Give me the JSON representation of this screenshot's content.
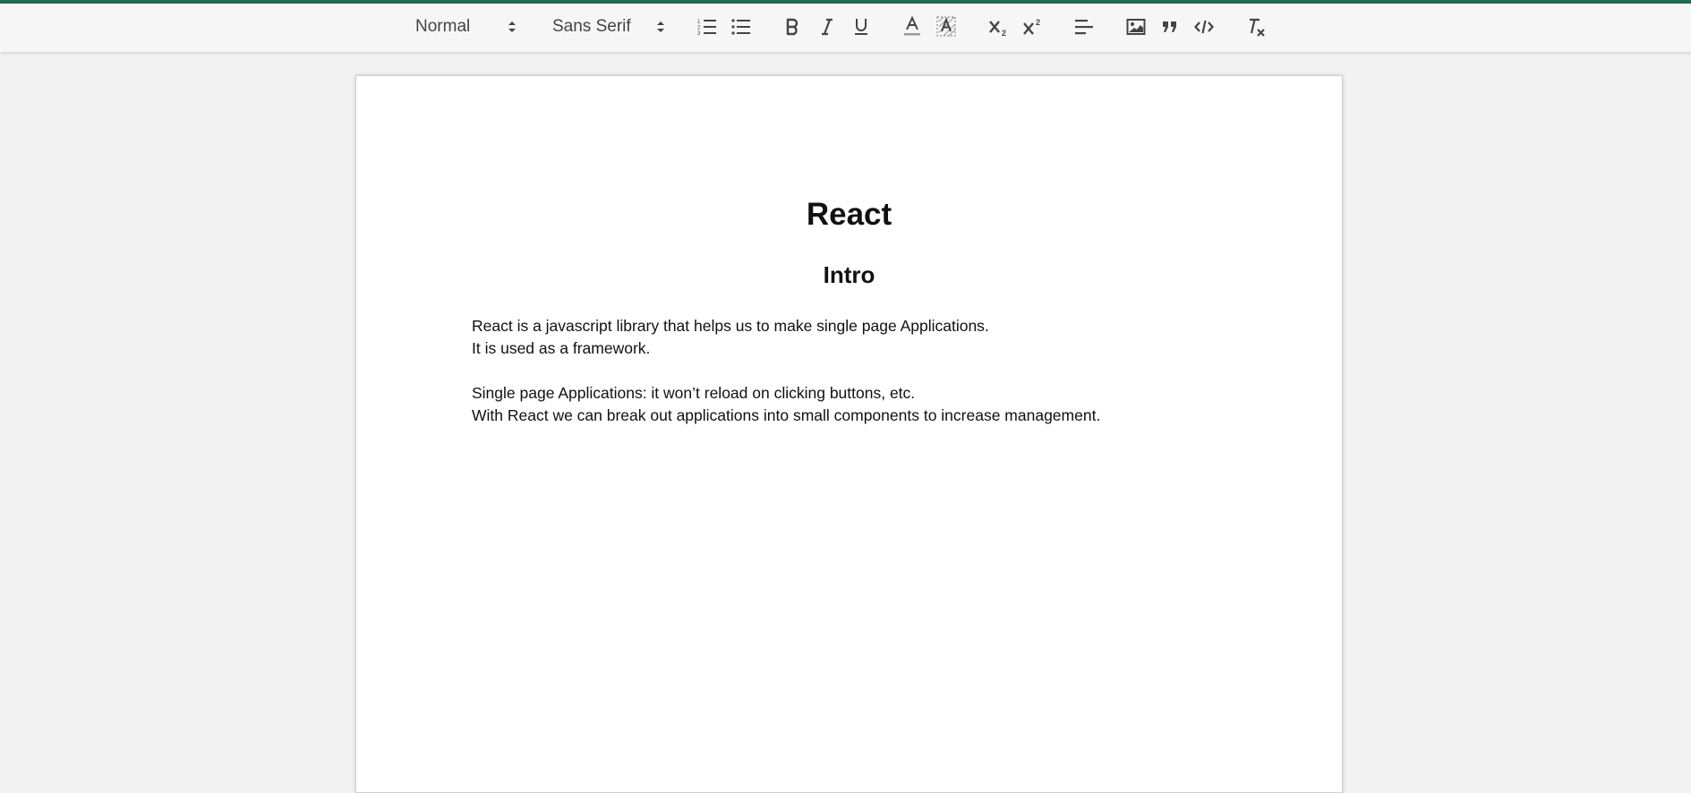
{
  "toolbar": {
    "header_select": {
      "value": "Normal",
      "icon": "up-down-arrows-icon"
    },
    "font_select": {
      "value": "Sans Serif",
      "icon": "up-down-arrows-icon"
    },
    "buttons": [
      {
        "name": "ordered-list-button",
        "icon": "ordered-list-icon"
      },
      {
        "name": "bullet-list-button",
        "icon": "bullet-list-icon"
      },
      {
        "name": "bold-button",
        "icon": "bold-icon"
      },
      {
        "name": "italic-button",
        "icon": "italic-icon"
      },
      {
        "name": "underline-button",
        "icon": "underline-icon"
      },
      {
        "name": "text-color-button",
        "icon": "text-color-icon"
      },
      {
        "name": "background-color-button",
        "icon": "background-color-icon"
      },
      {
        "name": "subscript-button",
        "icon": "subscript-icon"
      },
      {
        "name": "superscript-button",
        "icon": "superscript-icon"
      },
      {
        "name": "align-button",
        "icon": "align-left-icon"
      },
      {
        "name": "image-button",
        "icon": "image-icon"
      },
      {
        "name": "blockquote-button",
        "icon": "quote-icon"
      },
      {
        "name": "code-block-button",
        "icon": "code-icon"
      },
      {
        "name": "clear-formatting-button",
        "icon": "clear-format-icon"
      }
    ]
  },
  "document": {
    "title": "React",
    "subtitle": "Intro",
    "paragraphs": [
      "React is a javascript library that helps us to make single page Applications.",
      "It is used as a framework.",
      "Single page Applications: it won’t reload on clicking buttons, etc.",
      "With React we can break out applications into small components to increase management."
    ]
  },
  "colors": {
    "accent_bar": "#1e6b4f",
    "toolbar_bg": "#f6f6f6",
    "page_bg": "#ffffff",
    "canvas_bg": "#f3f3f3"
  }
}
